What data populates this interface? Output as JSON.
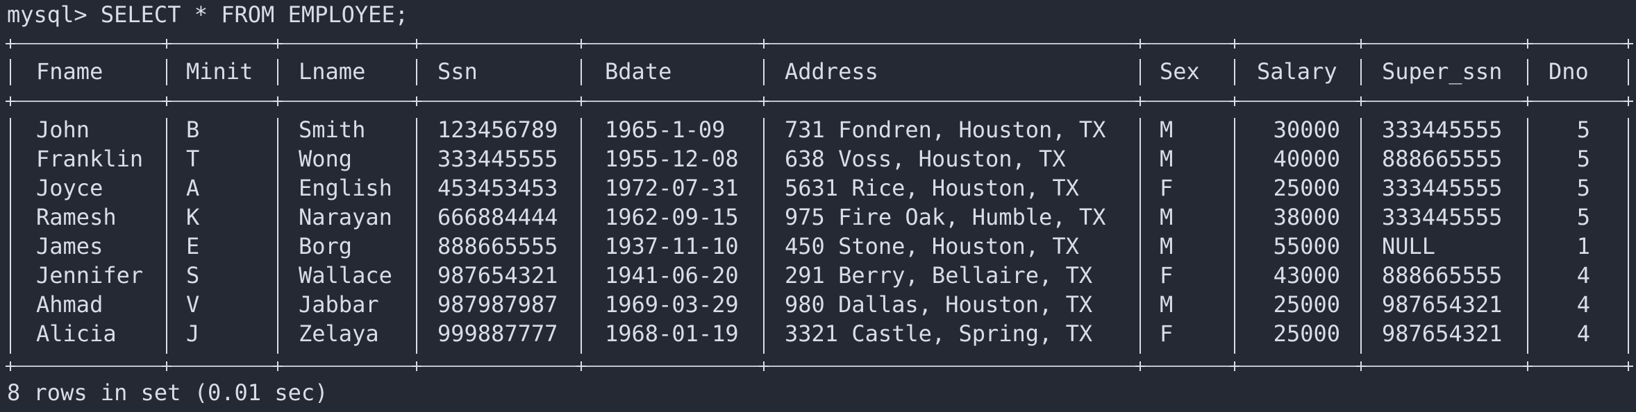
{
  "terminal": {
    "prompt": "mysql>",
    "command": "SELECT * FROM EMPLOYEE;",
    "footer": "8 rows in set (0.01 sec)"
  },
  "table": {
    "columns": [
      "Fname",
      "Minit",
      "Lname",
      "Ssn",
      "Bdate",
      "Address",
      "Sex",
      "Salary",
      "Super_ssn",
      "Dno"
    ],
    "rows": [
      [
        "John",
        "B",
        "Smith",
        "123456789",
        "1965-1-09",
        "731 Fondren, Houston, TX",
        "M",
        "30000",
        "333445555",
        "5"
      ],
      [
        "Franklin",
        "T",
        "Wong",
        "333445555",
        "1955-12-08",
        "638 Voss, Houston, TX",
        "M",
        "40000",
        "888665555",
        "5"
      ],
      [
        "Joyce",
        "A",
        "English",
        "453453453",
        "1972-07-31",
        "5631 Rice, Houston, TX",
        "F",
        "25000",
        "333445555",
        "5"
      ],
      [
        "Ramesh",
        "K",
        "Narayan",
        "666884444",
        "1962-09-15",
        "975 Fire Oak, Humble, TX",
        "M",
        "38000",
        "333445555",
        "5"
      ],
      [
        "James",
        "E",
        "Borg",
        "888665555",
        "1937-11-10",
        "450 Stone, Houston, TX",
        "M",
        "55000",
        "NULL",
        "1"
      ],
      [
        "Jennifer",
        "S",
        "Wallace",
        "987654321",
        "1941-06-20",
        "291 Berry, Bellaire, TX",
        "F",
        "43000",
        "888665555",
        "4"
      ],
      [
        "Ahmad",
        "V",
        "Jabbar",
        "987987987",
        "1969-03-29",
        "980 Dallas, Houston, TX",
        "M",
        "25000",
        "987654321",
        "4"
      ],
      [
        "Alicia",
        "J",
        "Zelaya",
        "999887777",
        "1968-01-19",
        "3321 Castle, Spring, TX",
        "F",
        "25000",
        "987654321",
        "4"
      ]
    ]
  }
}
